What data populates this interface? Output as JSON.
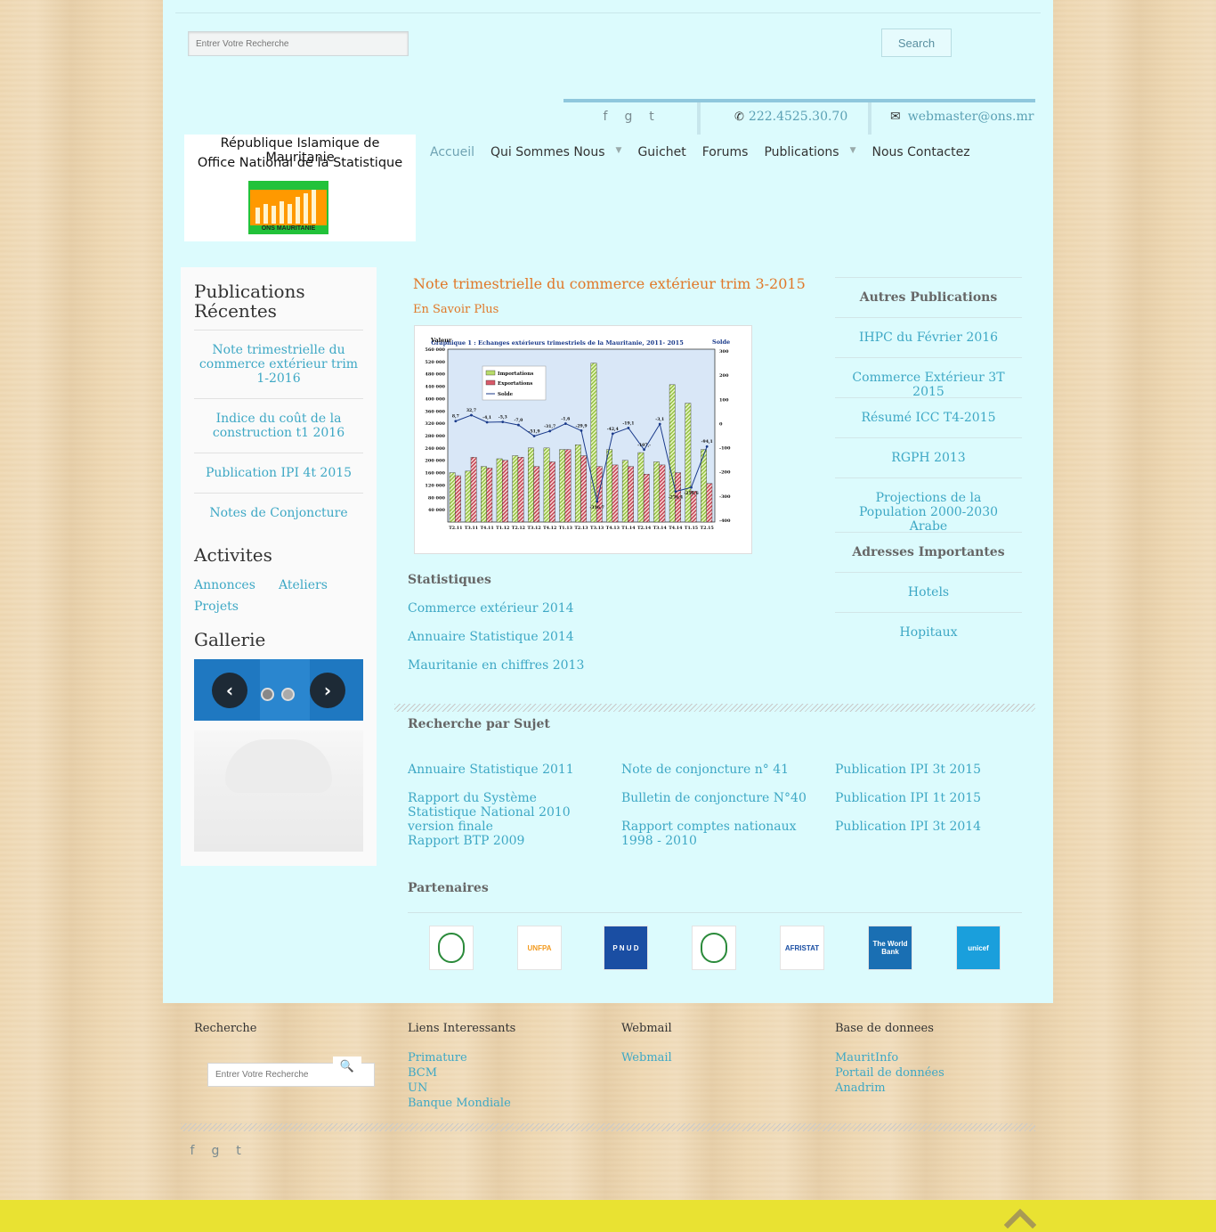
{
  "search": {
    "placeholder": "Entrer Votre Recherche",
    "button_label": "Search"
  },
  "contact": {
    "social": [
      "f",
      "g",
      "t"
    ],
    "phone": "222.4525.30.70",
    "email": "webmaster@ons.mr"
  },
  "logo": {
    "line1": "République Islamique de Mauritanie",
    "line2": "Office National de la Statistique",
    "chart_caption": "ONS MAURITANIE"
  },
  "nav": {
    "items": [
      {
        "label": "Accueil",
        "active": true
      },
      {
        "label": "Qui Sommes Nous",
        "has_dropdown": true
      },
      {
        "label": "Guichet"
      },
      {
        "label": "Forums"
      },
      {
        "label": "Publications",
        "has_dropdown": true
      },
      {
        "label": "Nous Contactez"
      }
    ]
  },
  "sidebar": {
    "recent_title": "Publications Récentes",
    "recent_items": [
      "Note trimestrielle du commerce extérieur trim 1-2016",
      "Indice du coût de la construction t1 2016",
      "Publication IPI 4t 2015",
      "Notes de Conjoncture"
    ],
    "activities_title": "Activites",
    "activities": [
      "Annonces",
      "Ateliers",
      "Projets"
    ],
    "gallery_title": "Gallerie"
  },
  "featured": {
    "title": "Note trimestrielle du commerce extérieur trim 3-2015",
    "more": "En Savoir Plus",
    "chart": {
      "title": "Graphique 1 : Echanges extérieurs trimestriels de la Mauritanie, 2011- 2015",
      "left_axis_label": "Valeur",
      "right_axis_label": "Solde",
      "legend": [
        "Importations",
        "Exportations",
        "Solde"
      ],
      "categories": [
        "T2.11",
        "T3.11",
        "T4.11",
        "T1.12",
        "T2.12",
        "T3.12",
        "T4.12",
        "T1.13",
        "T2.13",
        "T3.13",
        "T4.13",
        "T1.14",
        "T2.14",
        "T3.14",
        "T4.14",
        "T1.15",
        "T2.15"
      ],
      "left_ticks": [
        "560 000",
        "520 000",
        "480 000",
        "440 000",
        "400 000",
        "360 000",
        "320 000",
        "280 000",
        "240 000",
        "200 000",
        "160 000",
        "120 000",
        "80 000",
        "40 000"
      ],
      "right_ticks": [
        "300",
        "200",
        "100",
        "0",
        "-100",
        "-200",
        "-300",
        "-400"
      ],
      "imports": [
        160000,
        165000,
        180000,
        205000,
        215000,
        240000,
        240000,
        235000,
        250000,
        515000,
        235000,
        200000,
        225000,
        195000,
        445000,
        385000,
        235000
      ],
      "exports": [
        150000,
        210000,
        175000,
        200000,
        210000,
        180000,
        195000,
        235000,
        215000,
        180000,
        185000,
        180000,
        155000,
        185000,
        160000,
        100000,
        125000
      ],
      "solde": [
        8.7,
        32.7,
        4.1,
        5.3,
        -7.0,
        -51.9,
        -31.7,
        -1.6,
        -29.9,
        -316.7,
        -42.4,
        -19.1,
        -107,
        -3.1,
        -276.4,
        -259.6,
        -94.1
      ],
      "solde_labels": [
        "8,7",
        "32,7",
        "-4,1",
        "-5,3",
        "-7,0",
        "-51,9",
        "-31,7",
        "-1,6",
        "-29,9",
        "-316,7",
        "-42,4",
        "-19,1",
        "-107,-",
        "-3,1",
        "-276,4",
        "-259,6",
        "-94,1"
      ]
    }
  },
  "stats": {
    "title": "Statistiques",
    "links": [
      "Commerce extérieur 2014",
      "Annuaire Statistique 2014",
      "Mauritanie en chiffres 2013"
    ]
  },
  "right": {
    "other_title": "Autres Publications",
    "other_items": [
      "IHPC du Février 2016",
      "Commerce Extérieur 3T 2015",
      "Résumé ICC T4-2015",
      "RGPH 2013",
      "Projections de la Population 2000-2030 Arabe"
    ],
    "addr_title": "Adresses Importantes",
    "addr_items": [
      "Hotels",
      "Hopitaux"
    ]
  },
  "subject": {
    "title": "Recherche par Sujet",
    "col1": [
      "Annuaire Statistique 2011",
      "Rapport du Système Statistique National 2010 version finale",
      "Rapport BTP 2009"
    ],
    "col2": [
      "Note de conjoncture n° 41",
      "Bulletin de conjoncture N°40",
      "Rapport comptes nationaux 1998 - 2010"
    ],
    "col3": [
      "Publication IPI 3t 2015",
      "Publication IPI 1t 2015",
      "Publication IPI 3t 2014"
    ]
  },
  "partners": {
    "title": "Partenaires",
    "logos": [
      {
        "name": "fund-arabe",
        "text": "",
        "bg": "#ffffff",
        "fg": "#2a8a3a"
      },
      {
        "name": "unfpa",
        "text": "UNFPA",
        "bg": "#ffffff",
        "fg": "#f39a1e"
      },
      {
        "name": "pnud",
        "text": "P N U D",
        "bg": "#1a4ea3",
        "fg": "#ffffff"
      },
      {
        "name": "bad",
        "text": "",
        "bg": "#ffffff",
        "fg": "#2a8a3a"
      },
      {
        "name": "afristat",
        "text": "AFRISTAT",
        "bg": "#ffffff",
        "fg": "#1a4ea3"
      },
      {
        "name": "world-bank",
        "text": "The World Bank",
        "bg": "#1a6fb3",
        "fg": "#ffffff"
      },
      {
        "name": "unicef",
        "text": "unicef",
        "bg": "#1a9fdc",
        "fg": "#ffffff"
      }
    ]
  },
  "footer": {
    "search_title": "Recherche",
    "search_placeholder": "Entrer Votre Recherche",
    "links_title": "Liens Interessants",
    "links": [
      "Primature",
      "BCM",
      "UN",
      "Banque Mondiale"
    ],
    "webmail_title": "Webmail",
    "webmail_links": [
      "Webmail"
    ],
    "db_title": "Base de donnees",
    "db_links": [
      "MauritInfo",
      "Portail de données",
      "Anadrim"
    ],
    "social": [
      "f",
      "g",
      "t"
    ]
  },
  "colors": {
    "accent": "#3ea8c5",
    "feature": "#e07828",
    "page_bg": "#dcfbfd",
    "bottom_bar": "#e9e232"
  }
}
